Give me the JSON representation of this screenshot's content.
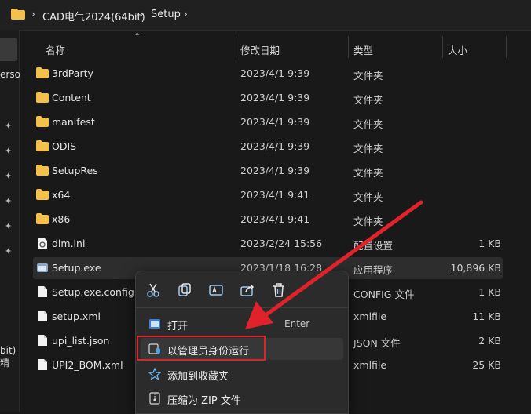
{
  "breadcrumb": {
    "items": [
      "CAD电气2024(64bit)",
      "Setup"
    ]
  },
  "left_pane": {
    "text_top": "erso",
    "text_bottom": "bit)精"
  },
  "columns": {
    "name": "名称",
    "date": "修改日期",
    "type": "类型",
    "size": "大小"
  },
  "files": [
    {
      "name": "3rdParty",
      "date": "2023/4/1 9:39",
      "type": "文件夹",
      "size": "",
      "icon": "folder-icon"
    },
    {
      "name": "Content",
      "date": "2023/4/1 9:39",
      "type": "文件夹",
      "size": "",
      "icon": "folder-icon"
    },
    {
      "name": "manifest",
      "date": "2023/4/1 9:39",
      "type": "文件夹",
      "size": "",
      "icon": "folder-icon"
    },
    {
      "name": "ODIS",
      "date": "2023/4/1 9:39",
      "type": "文件夹",
      "size": "",
      "icon": "folder-icon"
    },
    {
      "name": "SetupRes",
      "date": "2023/4/1 9:39",
      "type": "文件夹",
      "size": "",
      "icon": "folder-icon"
    },
    {
      "name": "x64",
      "date": "2023/4/1 9:41",
      "type": "文件夹",
      "size": "",
      "icon": "folder-icon"
    },
    {
      "name": "x86",
      "date": "2023/4/1 9:41",
      "type": "文件夹",
      "size": "",
      "icon": "folder-icon"
    },
    {
      "name": "dlm.ini",
      "date": "2023/2/24 15:56",
      "type": "配置设置",
      "size": "1 KB",
      "icon": "settings-file-icon"
    },
    {
      "name": "Setup.exe",
      "date": "2023/1/18 16:28",
      "type": "应用程序",
      "size": "10,896 KB",
      "icon": "exe-icon"
    },
    {
      "name": "Setup.exe.config",
      "date": "",
      "type": "CONFIG 文件",
      "size": "1 KB",
      "icon": "file-icon"
    },
    {
      "name": "setup.xml",
      "date": "",
      "type": "xmlfile",
      "size": "11 KB",
      "icon": "file-icon"
    },
    {
      "name": "upi_list.json",
      "date": "",
      "type": "JSON 文件",
      "size": "2 KB",
      "icon": "file-icon"
    },
    {
      "name": "UPI2_BOM.xml",
      "date": "",
      "type": "xmlfile",
      "size": "25 KB",
      "icon": "file-icon"
    }
  ],
  "context_menu": {
    "quick_actions": [
      "cut-icon",
      "copy-icon",
      "rename-icon",
      "share-icon",
      "delete-icon"
    ],
    "items": [
      {
        "label": "打开",
        "shortcut": "Enter",
        "icon": "open-app-icon"
      },
      {
        "label": "以管理员身份运行",
        "shortcut": "",
        "icon": "shield-admin-icon"
      },
      {
        "label": "添加到收藏夹",
        "shortcut": "",
        "icon": "star-icon"
      },
      {
        "label": "压缩为 ZIP 文件",
        "shortcut": "",
        "icon": "zip-icon"
      }
    ]
  },
  "colors": {
    "highlight": "#e0222b",
    "folder": "#f3c04a",
    "accent": "#4aa3f0"
  }
}
